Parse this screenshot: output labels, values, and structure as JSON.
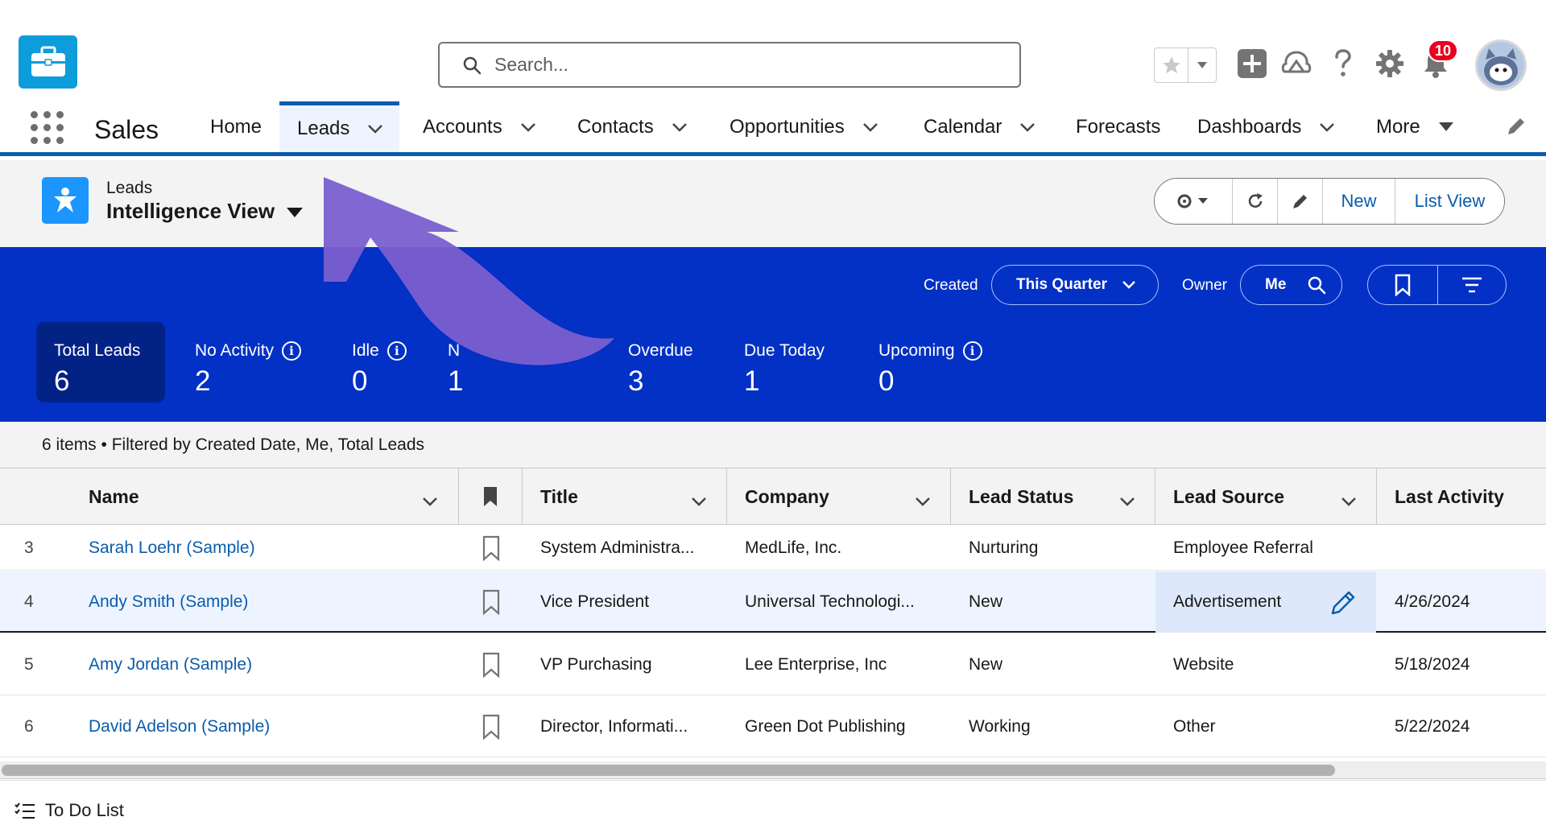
{
  "header": {
    "search_placeholder": "Search...",
    "notifications_count": "10",
    "icons": [
      "favorites-star-icon",
      "chevron-down-icon",
      "global-actions-plus-icon",
      "trailhead-icon",
      "help-icon",
      "setup-gear-icon",
      "notification-bell-icon",
      "avatar"
    ]
  },
  "nav": {
    "app_name": "Sales",
    "items": [
      {
        "label": "Home"
      },
      {
        "label": "Leads"
      },
      {
        "label": "Accounts"
      },
      {
        "label": "Contacts"
      },
      {
        "label": "Opportunities"
      },
      {
        "label": "Calendar"
      },
      {
        "label": "Forecasts"
      },
      {
        "label": "Dashboards"
      },
      {
        "label": "More"
      }
    ],
    "active": "Leads"
  },
  "page_header": {
    "object_label": "Leads",
    "view_name": "Intelligence View",
    "actions": {
      "new": "New",
      "list_view": "List View"
    }
  },
  "intel": {
    "created_label": "Created",
    "created_value": "This Quarter",
    "owner_label": "Owner",
    "owner_value": "Me",
    "metrics": [
      {
        "label": "Total Leads",
        "value": "6"
      },
      {
        "label": "No Activity",
        "value": "2"
      },
      {
        "label": "Idle",
        "value": "0"
      },
      {
        "label": "N",
        "value": "1"
      },
      {
        "label": "Overdue",
        "value": "3"
      },
      {
        "label": "Due Today",
        "value": "1"
      },
      {
        "label": "Upcoming",
        "value": "0"
      }
    ]
  },
  "summary": "6 items • Filtered by Created Date, Me, Total Leads",
  "table": {
    "columns": [
      "Name",
      "Title",
      "Company",
      "Lead Status",
      "Lead Source",
      "Last Activity"
    ],
    "rows": [
      {
        "num": "3",
        "name": "Sarah Loehr (Sample)",
        "title": "System Administra...",
        "company": "MedLife, Inc.",
        "status": "Nurturing",
        "source": "Employee Referral",
        "last_activity": ""
      },
      {
        "num": "4",
        "name": "Andy Smith (Sample)",
        "title": "Vice President",
        "company": "Universal Technologi...",
        "status": "New",
        "source": "Advertisement",
        "last_activity": "4/26/2024"
      },
      {
        "num": "5",
        "name": "Amy Jordan (Sample)",
        "title": "VP Purchasing",
        "company": "Lee Enterprise, Inc",
        "status": "New",
        "source": "Website",
        "last_activity": "5/18/2024"
      },
      {
        "num": "6",
        "name": "David Adelson (Sample)",
        "title": "Director, Informati...",
        "company": "Green Dot Publishing",
        "status": "Working",
        "source": "Other",
        "last_activity": "5/22/2024"
      }
    ]
  },
  "utility": {
    "todo_label": "To Do List"
  },
  "colors": {
    "brand_blue": "#0b5cab",
    "intel_blue": "#0330c5",
    "accent_cyan": "#0d9dda",
    "arrow_purple": "#7a5fd0"
  }
}
